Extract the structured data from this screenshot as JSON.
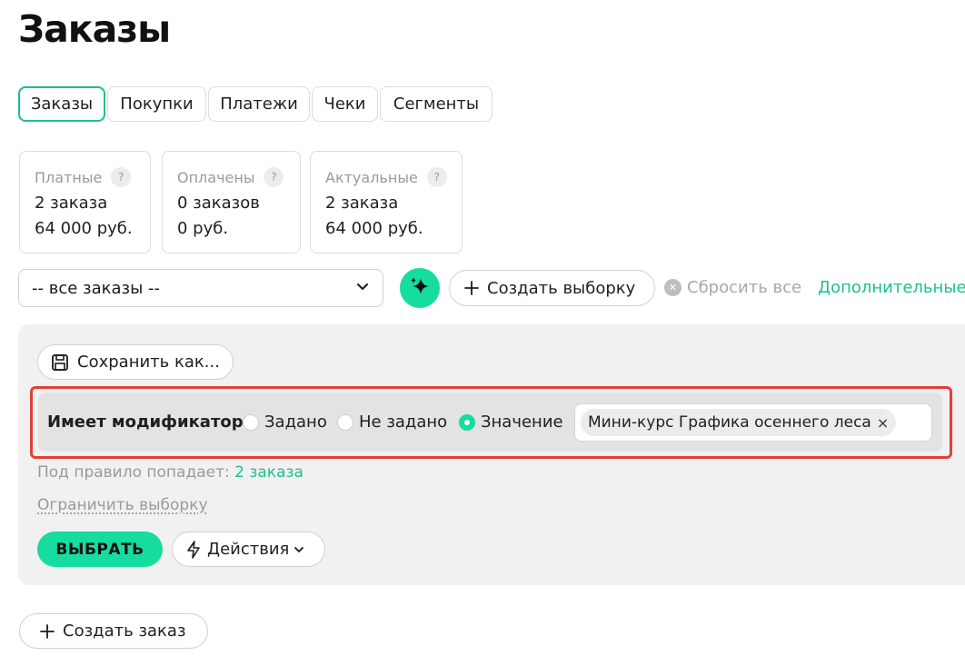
{
  "page": {
    "title": "Заказы"
  },
  "tabs": [
    {
      "label": "Заказы",
      "active": true
    },
    {
      "label": "Покупки",
      "active": false
    },
    {
      "label": "Платежи",
      "active": false
    },
    {
      "label": "Чеки",
      "active": false
    },
    {
      "label": "Сегменты",
      "active": false
    }
  ],
  "stats": [
    {
      "label": "Платные",
      "help": "?",
      "count": "2 заказа",
      "amount": "64 000 руб."
    },
    {
      "label": "Оплачены",
      "help": "?",
      "count": "0 заказов",
      "amount": "0 руб."
    },
    {
      "label": "Актуальные",
      "help": "?",
      "count": "2 заказа",
      "amount": "64 000 руб."
    }
  ],
  "filter": {
    "select_value": "-- все заказы --",
    "create_selection_label": "Создать выборку",
    "reset_label": "Сбросить все",
    "more_link": "Дополнительные"
  },
  "panel": {
    "save_as_label": "Сохранить как...",
    "rule": {
      "label": "Имеет модификатор",
      "options": [
        {
          "label": "Задано",
          "checked": false
        },
        {
          "label": "Не задано",
          "checked": false
        },
        {
          "label": "Значение",
          "checked": true
        }
      ],
      "chip_value": "Мини-курс Графика осеннего леса",
      "chip_remove": "×"
    },
    "hint_prefix": "Под правило попадает:",
    "hint_link": "2 заказа",
    "limit_label": "Ограничить выборку",
    "choose_label": "ВЫБРАТЬ",
    "actions_label": "Действия"
  },
  "footer": {
    "create_order_label": "Создать заказ"
  },
  "colors": {
    "accent": "#16dca0",
    "accent_text": "#1ebf8f",
    "highlight_border": "#e0403a"
  },
  "icons": [
    "chevron-down-icon",
    "sparkle-icon",
    "plus-icon",
    "close-circle-icon",
    "floppy-disk-icon",
    "lightning-icon"
  ]
}
